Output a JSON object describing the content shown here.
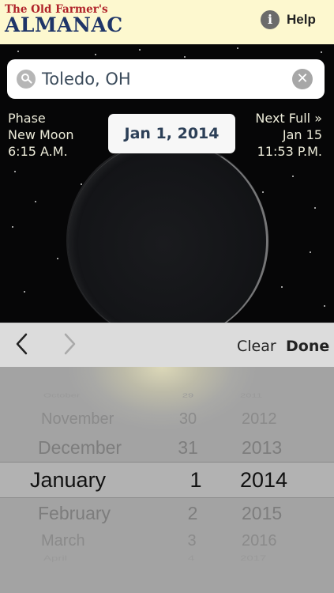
{
  "header": {
    "logo_top": "The Old Farmer's",
    "logo_main": "ALMANAC",
    "help_icon": "info-icon",
    "help_label": "Help"
  },
  "search": {
    "value": "Toledo, OH",
    "icon": "search-icon",
    "clear_icon": "clear-icon"
  },
  "phase": {
    "label": "Phase",
    "name": "New Moon",
    "time": "6:15 A.M."
  },
  "date_button": {
    "label": "Jan 1, 2014"
  },
  "next_full": {
    "label": "Next Full »",
    "date": "Jan 15",
    "time": "11:53 P.M."
  },
  "toolbar": {
    "prev_icon": "chevron-left-icon",
    "next_icon": "chevron-right-icon",
    "clear_label": "Clear",
    "done_label": "Done"
  },
  "picker": {
    "months": [
      "October",
      "November",
      "December",
      "January",
      "February",
      "March",
      "April"
    ],
    "days": [
      "29",
      "30",
      "31",
      "1",
      "2",
      "3",
      "4"
    ],
    "years": [
      "2011",
      "2012",
      "2013",
      "2014",
      "2015",
      "2016",
      "2017"
    ],
    "selected": {
      "month": "January",
      "day": "1",
      "year": "2014"
    }
  },
  "colors": {
    "header_bg": "#fdf8cf",
    "logo_red": "#b0232a",
    "logo_blue": "#1f3568",
    "date_text": "#2c3f57"
  }
}
